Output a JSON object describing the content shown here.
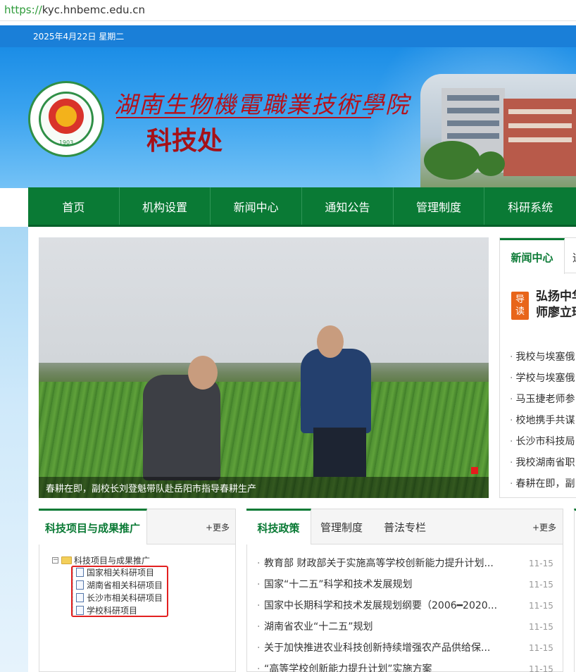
{
  "browser": {
    "url_scheme": "https://",
    "url_host": "kyc.hnbemc.edu.cn"
  },
  "topbar": {
    "date": "2025年4月22日 星期二"
  },
  "header": {
    "school_name": "湖南生物機電職業技術學院",
    "dept_name": "科技处",
    "logo_year": "1903"
  },
  "nav": {
    "items": [
      {
        "label": "首页"
      },
      {
        "label": "机构设置"
      },
      {
        "label": "新闻中心"
      },
      {
        "label": "通知公告"
      },
      {
        "label": "管理制度"
      },
      {
        "label": "科研系统"
      }
    ]
  },
  "hero": {
    "caption": "春耕在即，副校长刘登魁带队赴岳阳市指导春耕生产"
  },
  "news": {
    "tab_active": "新闻中心",
    "tab_other": "通",
    "guide_label": "导读",
    "headline_line1": "弘扬中华",
    "headline_line2": "师廖立瑶",
    "items": [
      "我校与埃塞俄",
      "学校与埃塞俄",
      "马玉捷老师参",
      "校地携手共谋",
      "长沙市科技局",
      "我校湖南省职",
      "春耕在即，副"
    ]
  },
  "achievements": {
    "title": "科技项目与成果推广",
    "more": "+更多",
    "tree_root": "科技项目与成果推广",
    "tree_children": [
      "国家相关科研项目",
      "湖南省相关科研项目",
      "长沙市相关科研项目",
      "学校科研项目"
    ]
  },
  "policy": {
    "tab_active": "科技政策",
    "tab_2": "管理制度",
    "tab_3": "普法专栏",
    "more": "+更多",
    "items": [
      {
        "title": "教育部 财政部关于实施高等学校创新能力提升计划...",
        "date": "11-15"
      },
      {
        "title": "国家“十二五”科学和技术发展规划",
        "date": "11-15"
      },
      {
        "title": "国家中长期科学和技术发展规划纲要（2006━2020...",
        "date": "11-15"
      },
      {
        "title": "湖南省农业“十二五”规划",
        "date": "11-15"
      },
      {
        "title": "关于加快推进农业科技创新持续增强农产品供给保...",
        "date": "11-15"
      },
      {
        "title": "“高等学校创新能力提升计划”实施方案",
        "date": "11-15"
      }
    ]
  },
  "colors": {
    "primary_green": "#0a7a35",
    "date_bar_blue": "#1a7fd8",
    "headline_red": "#b5121b",
    "guide_orange": "#e8651a",
    "highlight_red": "#e32020"
  }
}
